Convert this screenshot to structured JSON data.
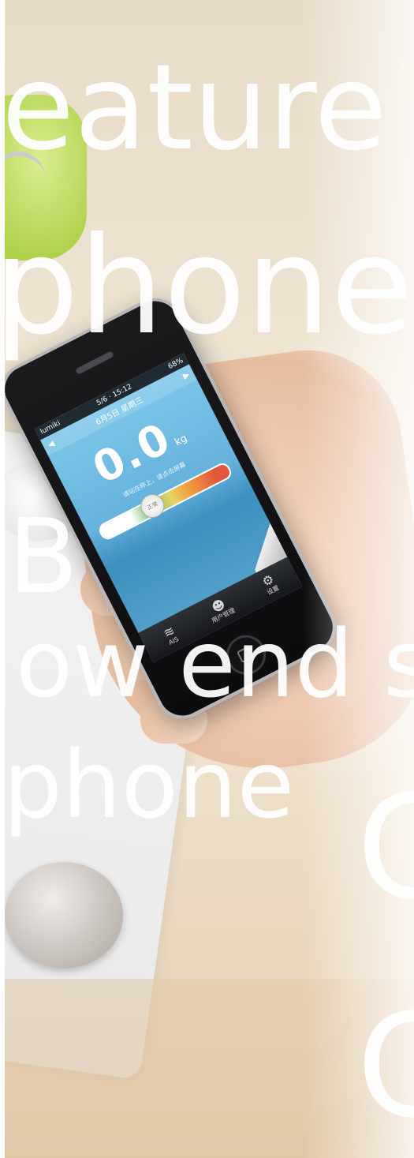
{
  "overlay_text": {
    "line1": "eature",
    "line2": "phone",
    "line3": "B",
    "line4": "ow end s",
    "line5": "phone",
    "line6": "C",
    "line7": "C"
  },
  "phone_screen": {
    "status": {
      "carrier": "lumiki",
      "time": "5/6 · 15:12",
      "battery": "68%"
    },
    "date_line": "6月5日 星期三",
    "weight_value": "0.0",
    "weight_unit": "kg",
    "hint": "请站在称上，请点击屏幕",
    "gauge_label": "正常",
    "tabs": [
      {
        "label": "AIS",
        "icon": "wifi-icon"
      },
      {
        "label": "用户管理",
        "icon": "user-icon"
      },
      {
        "label": "设置",
        "icon": "gear-icon"
      }
    ]
  }
}
